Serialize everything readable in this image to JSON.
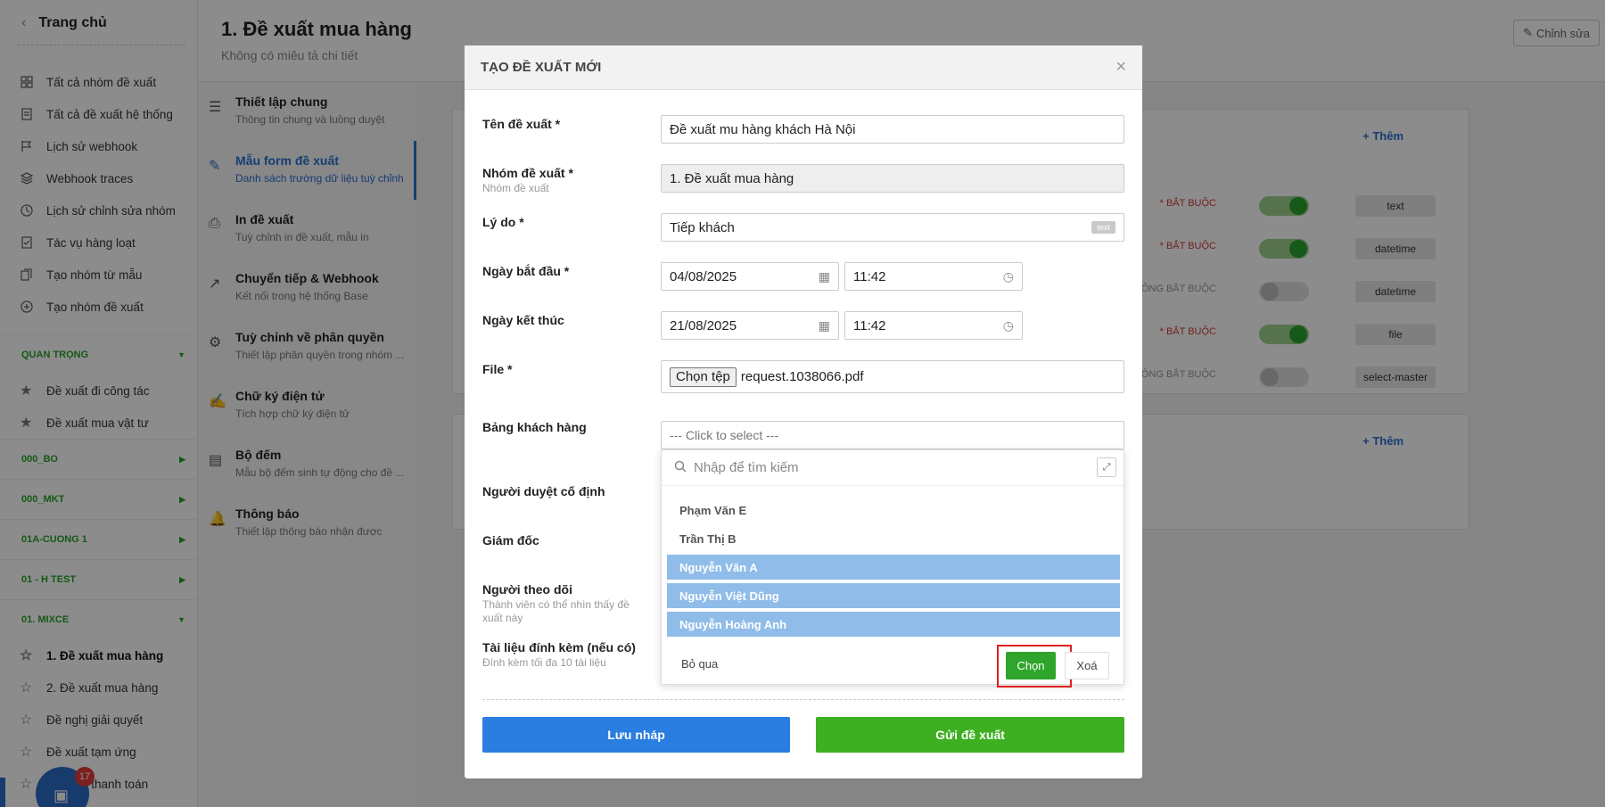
{
  "sidebar": {
    "home": "Trang chủ",
    "menu": [
      {
        "label": "Tất cả nhóm đề xuất",
        "icon": "grid-icon"
      },
      {
        "label": "Tất cả đề xuất hệ thống",
        "icon": "document-icon"
      },
      {
        "label": "Lịch sử webhook",
        "icon": "flag-icon"
      },
      {
        "label": "Webhook traces",
        "icon": "layers-icon"
      },
      {
        "label": "Lịch sử chỉnh sửa nhóm",
        "icon": "history-icon"
      },
      {
        "label": "Tác vụ hàng loạt",
        "icon": "checklist-icon"
      },
      {
        "label": "Tạo nhóm từ mẫu",
        "icon": "copy-icon"
      },
      {
        "label": "Tạo nhóm đề xuất",
        "icon": "plus-circle-icon"
      }
    ],
    "groups": [
      {
        "label": "QUAN TRỌNG",
        "items": [
          "Đề xuất đi công tác",
          "Đề xuất mua vật tư"
        ]
      },
      {
        "label": "000_BO"
      },
      {
        "label": "000_MKT"
      },
      {
        "label": "01A-CUONG 1"
      },
      {
        "label": "01 - H TEST"
      },
      {
        "label": "01. MIXCE",
        "items": [
          "1. Đề xuất mua hàng",
          "2. Đề xuất mua hàng",
          "Đề nghị giải quyết",
          "Đề xuất tạm ứng",
          "Đề xuất thanh toán"
        ]
      }
    ],
    "notif_count": "17"
  },
  "header": {
    "title": "1. Đề xuất mua hàng",
    "subtitle": "Không có miêu tả chi tiết",
    "edit": "Chỉnh sửa"
  },
  "settings": [
    {
      "title": "Thiết lập chung",
      "desc": "Thông tin chung và luồng duyệt"
    },
    {
      "title": "Mẫu form đề xuất",
      "desc": "Danh sách trường dữ liệu tuỳ chỉnh"
    },
    {
      "title": "In đề xuất",
      "desc": "Tuỳ chỉnh in đề xuất, mẫu in"
    },
    {
      "title": "Chuyển tiếp & Webhook",
      "desc": "Kết nối trong hệ thống Base"
    },
    {
      "title": "Tuỳ chỉnh về phân quyền",
      "desc": "Thiết lập phân quyền trong nhóm ..."
    },
    {
      "title": "Chữ ký điện tử",
      "desc": "Tích hợp chữ ký điện tử"
    },
    {
      "title": "Bộ đếm",
      "desc": "Mẫu bộ đếm sinh tự động cho đề ..."
    },
    {
      "title": "Thông báo",
      "desc": "Thiết lập thông báo nhận được"
    }
  ],
  "content": {
    "add_label": "+ Thêm",
    "fields": [
      {
        "req": "* BẮT BUỘC",
        "on": true,
        "type": "text"
      },
      {
        "req": "* BẮT BUỘC",
        "on": true,
        "type": "datetime"
      },
      {
        "req": "KHÔNG BẮT BUỘC",
        "on": false,
        "type": "datetime"
      },
      {
        "req": "* BẮT BUỘC",
        "on": true,
        "type": "file"
      },
      {
        "req": "KHÔNG BẮT BUỘC",
        "on": false,
        "type": "select-master"
      }
    ]
  },
  "modal": {
    "title": "TẠO ĐỀ XUẤT MỚI",
    "close": "×",
    "name_label": "Tên đề xuất *",
    "name_value": "Đề xuất mu hàng khách Hà Nội",
    "group_label": "Nhóm đề xuất *",
    "group_sub": "Nhóm đề xuất",
    "group_value": "1. Đề xuất mua hàng",
    "reason_label": "Lý do *",
    "reason_value": "Tiếp khách",
    "reason_tag": "text",
    "start_label": "Ngày bắt đầu *",
    "start_date": "04/08/2025",
    "start_time": "11:42",
    "end_label": "Ngày kết thúc",
    "end_date": "21/08/2025",
    "end_time": "11:42",
    "file_label": "File *",
    "file_button": "Chọn tệp",
    "file_name": "request.1038066.pdf",
    "customer_label": "Bảng khách hàng",
    "customer_placeholder": "--- Click to select ---",
    "approver_label": "Người duyệt cố định",
    "director_label": "Giám đốc",
    "follower_label": "Người theo dõi",
    "follower_sub": "Thành viên có thể nhìn thấy đề xuất này",
    "attach_label": "Tài liệu đính kèm (nếu có)",
    "attach_sub": "Đính kèm tối đa 10 tài liệu",
    "save_draft": "Lưu nháp",
    "submit": "Gửi đề xuất"
  },
  "dropdown": {
    "search_placeholder": "Nhập để tìm kiếm",
    "options": [
      {
        "label": "Phạm Văn E",
        "selected": false
      },
      {
        "label": "Trần Thị B",
        "selected": false
      },
      {
        "label": "Nguyễn Văn A",
        "selected": true
      },
      {
        "label": "Nguyễn Việt Dũng",
        "selected": true
      },
      {
        "label": "Nguyễn Hoàng Anh",
        "selected": true
      }
    ],
    "skip": "Bỏ qua",
    "choose": "Chọn",
    "clear": "Xoá"
  }
}
